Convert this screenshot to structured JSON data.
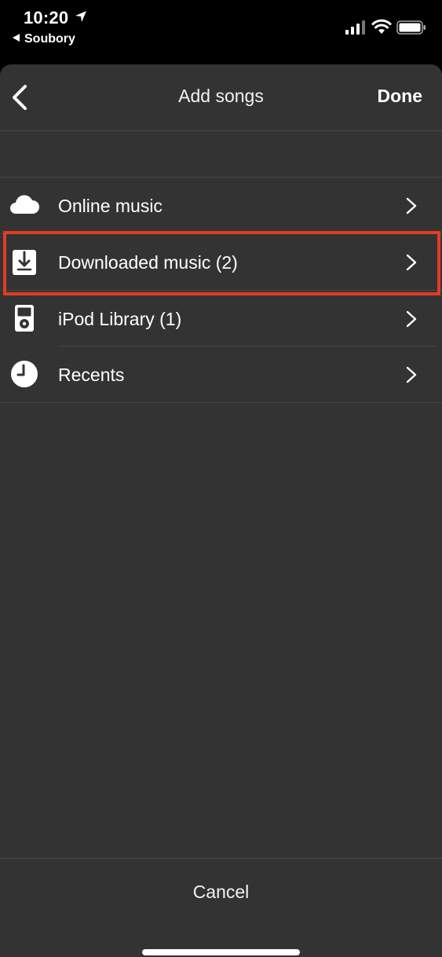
{
  "status_bar": {
    "time": "10:20",
    "back_app": "Soubory"
  },
  "nav": {
    "title": "Add songs",
    "done_label": "Done"
  },
  "sources": [
    {
      "label": "Online music",
      "icon": "cloud-icon"
    },
    {
      "label": "Downloaded music (2)",
      "icon": "download-icon"
    },
    {
      "label": "iPod Library (1)",
      "icon": "ipod-icon"
    },
    {
      "label": "Recents",
      "icon": "clock-icon"
    }
  ],
  "highlight_color": "#e53b25",
  "cancel_label": "Cancel"
}
